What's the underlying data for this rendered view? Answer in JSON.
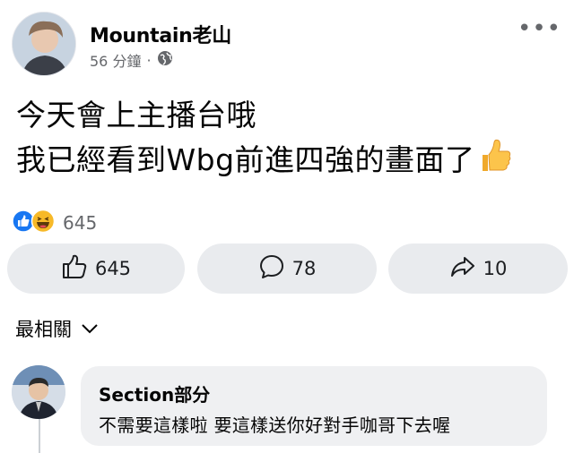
{
  "post": {
    "author": "Mountain老山",
    "time": "56 分鐘",
    "separator": "·",
    "text": "今天會上主播台哦\n我已經看到Wbg前進四強的畫面了",
    "reaction_count": "645"
  },
  "actions": {
    "like_count": "645",
    "comment_count": "78",
    "share_count": "10"
  },
  "sort_label": "最相關",
  "comments": [
    {
      "name": "Section部分",
      "text": "不需要這樣啦 要這樣送你好對手咖哥下去喔"
    }
  ],
  "colors": {
    "facebook_blue": "#1877f2",
    "haha_yellow": "#f7b928",
    "bubble_gray": "#eff0f2"
  },
  "icons": [
    "more-icon",
    "globe-icon",
    "thumbs-up-emoji",
    "like-reaction-icon",
    "haha-reaction-icon",
    "like-icon",
    "comment-icon",
    "share-icon",
    "chevron-down-icon"
  ]
}
